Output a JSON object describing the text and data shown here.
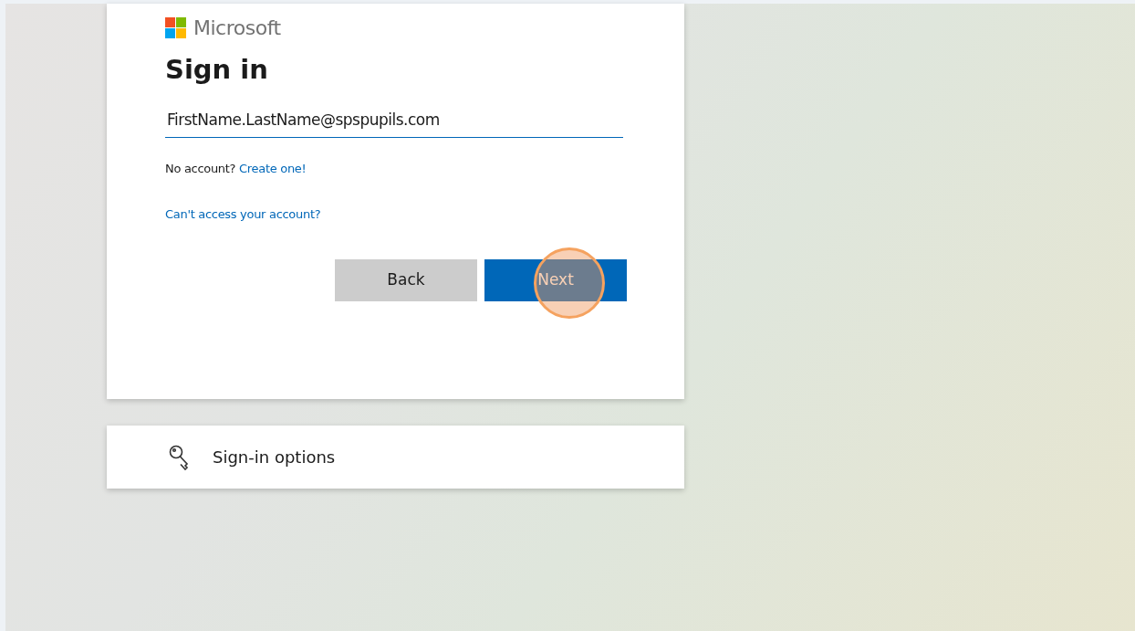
{
  "brand": "Microsoft",
  "title": "Sign in",
  "email_field": {
    "value": "FirstName.LastName@spspupils.com",
    "focused": true
  },
  "signup_prompt": {
    "text": "No account?",
    "link": "Create one!"
  },
  "recovery_link": "Can't access your account?",
  "buttons": [
    {
      "label": "Back",
      "kind": "secondary",
      "click_highlight": false
    },
    {
      "label": "Next",
      "kind": "primary",
      "click_highlight": true
    }
  ],
  "options_card": {
    "label": "Sign-in options"
  }
}
